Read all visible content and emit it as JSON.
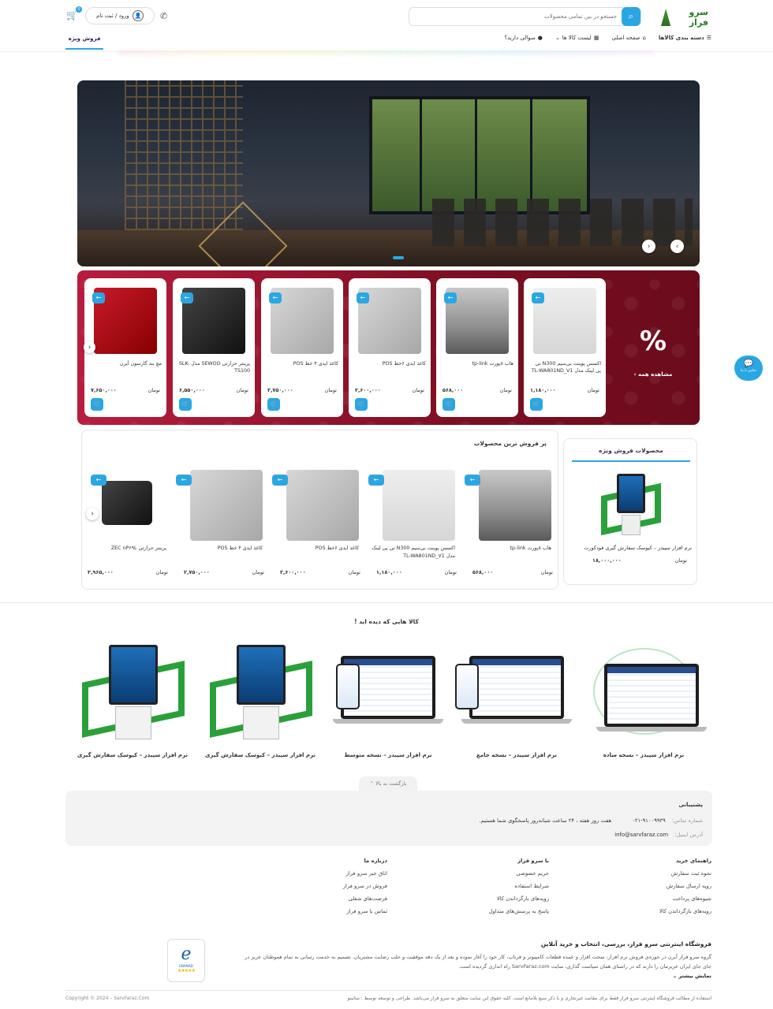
{
  "header": {
    "logo_text": "سرو فراز",
    "search_placeholder": "جستجو در بین تمامی محصولات",
    "login_label": "ورود / ثبت نام",
    "cart_count": "0"
  },
  "nav": {
    "items": [
      {
        "label": "دسته بندی کالاها",
        "icon": "menu-icon"
      },
      {
        "label": "صفحه اصلی",
        "icon": "home-icon"
      },
      {
        "label": "لیست کالا ها",
        "icon": "store-icon"
      },
      {
        "label": "سوالی دارید؟",
        "icon": "question-icon"
      }
    ],
    "special_sale": "فروش ویژه"
  },
  "offer": {
    "percent_symbol": "%",
    "see_all": "مشاهده همه ›",
    "currency": "تومان",
    "products": [
      {
        "name": "اکسس پوینت بی‌سیم N300 تی پی لینک مدل TL-WA801ND_V1",
        "price": "۱,۱۸۰,۰۰۰",
        "img": "router"
      },
      {
        "name": "هاب ۸پورت tp-link",
        "price": "۵۶۸,۰۰۰",
        "img": "hub"
      },
      {
        "name": "کاغذ ایدی ۶خط POS",
        "price": "۲,۶۰۰,۰۰۰",
        "img": "gray"
      },
      {
        "name": "کاغذ ایدی ۴ خط POS",
        "price": "۲,۷۵۰,۰۰۰",
        "img": "gray"
      },
      {
        "name": "پرینتر حرارتی SEWOO مدل SLK-TS100",
        "price": "۶,۵۵۰,۰۰۰",
        "img": "printer"
      },
      {
        "name": "مچ بند گارسون آیرن",
        "price": "۷,۶۵۰,۰۰۰",
        "img": "red"
      }
    ]
  },
  "special_box": {
    "title": "محصولات فروش ویژه",
    "product_name": "نرم افزار سپیدز – کیوسک سفارش گیری فودکورت",
    "price": "۱۸,۰۰۰,۰۰۰",
    "currency": "تومان"
  },
  "bestsellers": {
    "title": "پر فروش ترین محصولات",
    "currency": "تومان",
    "products": [
      {
        "name": "هاب ۸پورت tp-link",
        "price": "۵۶۸,۰۰۰",
        "img": "hub"
      },
      {
        "name": "اکسس پوینت بی‌سیم N300 تی پی لینک مدل TL-WA801ND_V1",
        "price": "۱,۱۸۰,۰۰۰",
        "img": "router"
      },
      {
        "name": "کاغذ ایدی ۶خط POS",
        "price": "۲,۶۰۰,۰۰۰",
        "img": "gray"
      },
      {
        "name": "کاغذ ایدی ۴ خط POS",
        "price": "۲,۷۵۰,۰۰۰",
        "img": "gray"
      },
      {
        "name": "پرینتر حرارتی ZEC nP۶۹L",
        "price": "۳,۹۶۵,۰۰۰",
        "img": "printer"
      }
    ]
  },
  "seen": {
    "title": "کالا هایی که دیده اید !",
    "items": [
      {
        "name": "نرم افزار سپیدز – نسخه ساده",
        "kind": "laptop"
      },
      {
        "name": "نرم افزار سپیدز – نسخه جامع",
        "kind": "laptop"
      },
      {
        "name": "نرم افزار سپیدز – نسخه متوسط",
        "kind": "laptop"
      },
      {
        "name": "نرم افزار سپیدز – کیوسک سفارش گیری",
        "kind": "kiosk"
      },
      {
        "name": "نرم افزار سپیدز – کیوسک سفارش گیری",
        "kind": "kiosk"
      }
    ]
  },
  "back_to_top": "بازگشت به بالا ⌃",
  "support": {
    "title": "پشتیبانی",
    "phone_label": "شماره تماس:",
    "phone": "۰۲۱-۹۱۰۰۹۹۳۹",
    "hours": "هفت روز هفته ، ۲۴ ساعت شبانه‌روز پاسخگوی شما هستیم.",
    "email_label": "آدرس ایمیل:",
    "email": "info@sarvfaraz.com"
  },
  "footer_cols": [
    {
      "title": "راهنمای خرید",
      "links": [
        "نحوه ثبت سفارش",
        "رویه ارسال سفارش",
        "شیوه‌های پرداخت",
        "رویه‌های بازگرداندن کالا"
      ]
    },
    {
      "title": "با سرو فراز",
      "links": [
        "حریم خصوصی",
        "شرایط استفاده",
        "رویه‌های بازگرداندن کالا",
        "پاسخ به پرسش‌های متداول"
      ]
    },
    {
      "title": "درباره ما",
      "links": [
        "اتاق خبر سرو فراز",
        "فروش در سرو فراز",
        "فرصت‌های شغلی",
        "تماس با سرو فراز"
      ]
    }
  ],
  "about": {
    "title": "فروشگاه اینترنتی سرو فراز، بررسی، انتخاب و خرید آنلاین",
    "text": "گروه سرو فراز آیرن در حوزه‌ی فروش نرم افزار، سخت افزار و عمده قطعات کامپیوتر و فرتاپ، کار خود را آغاز نموده و بعد از یک دهه موفقیت و جلب رضایت مشتریان، تصمیم به خدمت رسانی به تمام هموطنان عزیز در جای جای ایران عزیزمان را دارند که در راستای همان سیاست گذاری، سایت SarvFaraz.com راه اندازی گردیده است.",
    "more": "نمایش بیشتر ⌄"
  },
  "enamad": {
    "letter": "e",
    "label": "ENAMAD",
    "stars": "★★★★★"
  },
  "chat": {
    "label": "تماس با ما"
  },
  "copyright": "Copyright © 2024 – SarvFaraz.Com",
  "rights": "استفاده از مطالب فروشگاه اینترنتی سرو فراز فقط برای مقاصد غیرتجاری و با ذکر منبع بلامانع است. کلیه حقوق این سایت متعلق به سرو فراز می‌باشد. طراحی و توسعه توسط : ساتینو"
}
